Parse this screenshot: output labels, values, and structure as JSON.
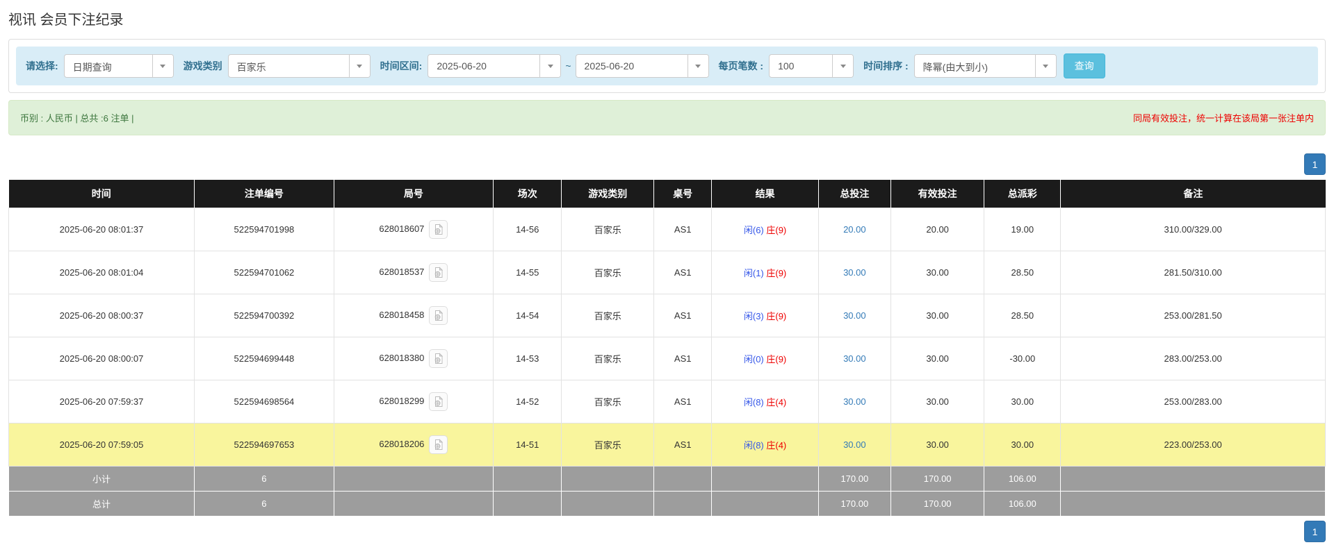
{
  "page": {
    "title": "视讯 会员下注纪录"
  },
  "filters": {
    "query_type_label": "请选择:",
    "query_type_value": "日期查询",
    "game_type_label": "游戏类别",
    "game_type_value": "百家乐",
    "time_range_label": "时间区间:",
    "date_from": "2025-06-20",
    "tilde": "~",
    "date_to": "2025-06-20",
    "page_size_label": "每页笔数 :",
    "page_size_value": "100",
    "sort_label": "时间排序 :",
    "sort_value": "降幂(由大到小)",
    "search_button": "查询"
  },
  "summary": {
    "left": "币别 : 人民币 | 总共 :6 注单 |",
    "right": "同局有效投注，统一计算在该局第一张注单内"
  },
  "pagination": {
    "page": "1"
  },
  "icons": {
    "dropdown_caret": "chevron-down triangle",
    "video_record": "document-with-film-reel"
  },
  "colors": {
    "filter_bar_bg": "#d9edf7",
    "filter_label": "#31708f",
    "search_button_bg": "#5bc0de",
    "summary_bg": "#dff0d8",
    "summary_text": "#3c763d",
    "summary_warning_red": "#ee0000",
    "table_header_bg": "#1b1b1b",
    "highlight_row_bg": "#f9f59d",
    "footer_row_bg": "#9d9d9d",
    "link_blue": "#337ab7",
    "player_blue": "#3355e8",
    "banker_red": "#ee0000",
    "negative_red": "#ee0000",
    "pager_blue": "#337ab7"
  },
  "table": {
    "headers": [
      "时间",
      "注单编号",
      "局号",
      "场次",
      "游戏类别",
      "桌号",
      "结果",
      "总投注",
      "有效投注",
      "总派彩",
      "备注"
    ],
    "rows": [
      {
        "time": "2025-06-20 08:01:37",
        "bet_id": "522594701998",
        "round_id": "628018607",
        "session": "14-56",
        "game": "百家乐",
        "table_no": "AS1",
        "result_player": "闲(6)",
        "result_banker": "庄(9)",
        "total_bet": "20.00",
        "valid_bet": "20.00",
        "payout": "19.00",
        "payout_negative": false,
        "remark": "310.00/329.00",
        "highlight": false
      },
      {
        "time": "2025-06-20 08:01:04",
        "bet_id": "522594701062",
        "round_id": "628018537",
        "session": "14-55",
        "game": "百家乐",
        "table_no": "AS1",
        "result_player": "闲(1)",
        "result_banker": "庄(9)",
        "total_bet": "30.00",
        "valid_bet": "30.00",
        "payout": "28.50",
        "payout_negative": false,
        "remark": "281.50/310.00",
        "highlight": false
      },
      {
        "time": "2025-06-20 08:00:37",
        "bet_id": "522594700392",
        "round_id": "628018458",
        "session": "14-54",
        "game": "百家乐",
        "table_no": "AS1",
        "result_player": "闲(3)",
        "result_banker": "庄(9)",
        "total_bet": "30.00",
        "valid_bet": "30.00",
        "payout": "28.50",
        "payout_negative": false,
        "remark": "253.00/281.50",
        "highlight": false
      },
      {
        "time": "2025-06-20 08:00:07",
        "bet_id": "522594699448",
        "round_id": "628018380",
        "session": "14-53",
        "game": "百家乐",
        "table_no": "AS1",
        "result_player": "闲(0)",
        "result_banker": "庄(9)",
        "total_bet": "30.00",
        "valid_bet": "30.00",
        "payout": "-30.00",
        "payout_negative": true,
        "remark": "283.00/253.00",
        "highlight": false
      },
      {
        "time": "2025-06-20 07:59:37",
        "bet_id": "522594698564",
        "round_id": "628018299",
        "session": "14-52",
        "game": "百家乐",
        "table_no": "AS1",
        "result_player": "闲(8)",
        "result_banker": "庄(4)",
        "total_bet": "30.00",
        "valid_bet": "30.00",
        "payout": "30.00",
        "payout_negative": false,
        "remark": "253.00/283.00",
        "highlight": false
      },
      {
        "time": "2025-06-20 07:59:05",
        "bet_id": "522594697653",
        "round_id": "628018206",
        "session": "14-51",
        "game": "百家乐",
        "table_no": "AS1",
        "result_player": "闲(8)",
        "result_banker": "庄(4)",
        "total_bet": "30.00",
        "valid_bet": "30.00",
        "payout": "30.00",
        "payout_negative": false,
        "remark": "223.00/253.00",
        "highlight": true
      }
    ],
    "footer": [
      {
        "label": "小计",
        "count": "6",
        "total_bet": "170.00",
        "valid_bet": "170.00",
        "payout": "106.00"
      },
      {
        "label": "总计",
        "count": "6",
        "total_bet": "170.00",
        "valid_bet": "170.00",
        "payout": "106.00"
      }
    ]
  }
}
